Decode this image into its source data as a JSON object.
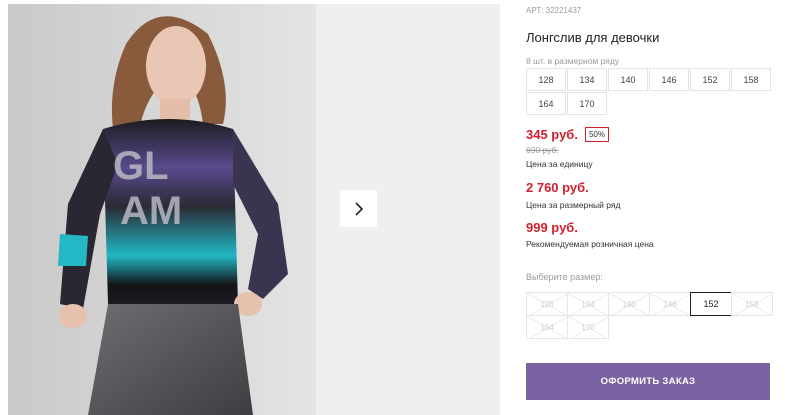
{
  "product": {
    "article_label": "АРТ:",
    "article": "32221437",
    "title": "Лонгслив для девочки",
    "sizes_note": "8 шт. в размерном ряду",
    "size_row": [
      "128",
      "134",
      "140",
      "146",
      "152",
      "158",
      "164",
      "170"
    ]
  },
  "prices": {
    "unit_price": "345 руб.",
    "discount": "50%",
    "old_price": "690 руб.",
    "unit_label": "Цена за единицу",
    "row_price": "2 760 руб.",
    "row_label": "Цена за размерный ряд",
    "rrp_price": "999 руб.",
    "rrp_label": "Рекомендуемая розничная цена"
  },
  "size_picker": {
    "label": "Выберите размер:",
    "options": [
      {
        "label": "128",
        "state": "unavailable"
      },
      {
        "label": "134",
        "state": "unavailable"
      },
      {
        "label": "140",
        "state": "unavailable"
      },
      {
        "label": "146",
        "state": "unavailable"
      },
      {
        "label": "152",
        "state": "selected"
      },
      {
        "label": "158",
        "state": "unavailable"
      },
      {
        "label": "164",
        "state": "unavailable"
      },
      {
        "label": "170",
        "state": "unavailable"
      }
    ]
  },
  "actions": {
    "order_button": "ОФОРМИТЬ ЗАКАЗ",
    "next_icon": "chevron-right-icon"
  },
  "colors": {
    "price_red": "#d0202e",
    "button_purple": "#7b62a3"
  }
}
